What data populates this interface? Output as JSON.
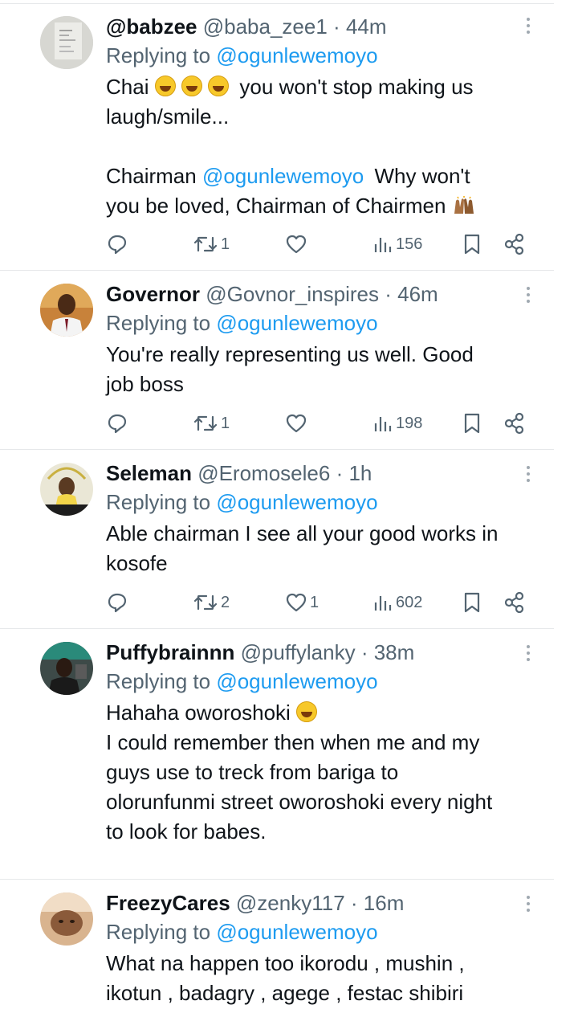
{
  "replying_label": "Replying to",
  "replying_to": "@ogunlewemoyo",
  "separator": "·",
  "tweets": [
    {
      "name": "@babzee",
      "handle": "@baba_zee1",
      "time": "44m",
      "line1a": "Chai",
      "line1b": "you won't stop making us",
      "line2": "laugh/smile...",
      "line3a": "Chairman",
      "line3mention": "@ogunlewemoyo",
      "line3b": "Why won't",
      "line4": "you be loved, Chairman of Chairmen",
      "reposts": "1",
      "likes": "",
      "views": "156"
    },
    {
      "name": "Governor",
      "handle": "@Govnor_inspires",
      "time": "46m",
      "line1": "You're really representing us well. Good",
      "line2": "job boss",
      "reposts": "1",
      "likes": "",
      "views": "198"
    },
    {
      "name": "Seleman",
      "handle": "@Eromosele6",
      "time": "1h",
      "line1": "Able chairman I see all your good works in",
      "line2": "kosofe",
      "reposts": "2",
      "likes": "1",
      "views": "602"
    },
    {
      "name": "Puffybrainnn",
      "handle": "@puffylanky",
      "time": "38m",
      "line1": "Hahaha oworoshoki",
      "line2": "I could remember then when me and my",
      "line3": "guys use to treck from bariga to",
      "line4": "olorunfunmi street oworoshoki every night",
      "line5": "to look for babes."
    },
    {
      "name": "FreezyCares",
      "handle": "@zenky117",
      "time": "16m",
      "line1": "What na happen too ikorodu , mushin ,",
      "line2": "ikotun , badagry , agege , festac shibiri"
    }
  ],
  "icons": {
    "reply": "speech-bubble-icon",
    "repost": "repost-arrows-icon",
    "like": "heart-icon",
    "views": "bar-chart-icon",
    "bookmark": "bookmark-icon",
    "share": "share-nodes-icon",
    "more": "vertical-dots-icon",
    "emoji_laugh": "grinning-squint-emoji",
    "emoji_hands": "raised-hands-emoji"
  },
  "colors": {
    "accent": "#1d9bf0",
    "text": "#0f1419",
    "secondary": "#536471"
  }
}
